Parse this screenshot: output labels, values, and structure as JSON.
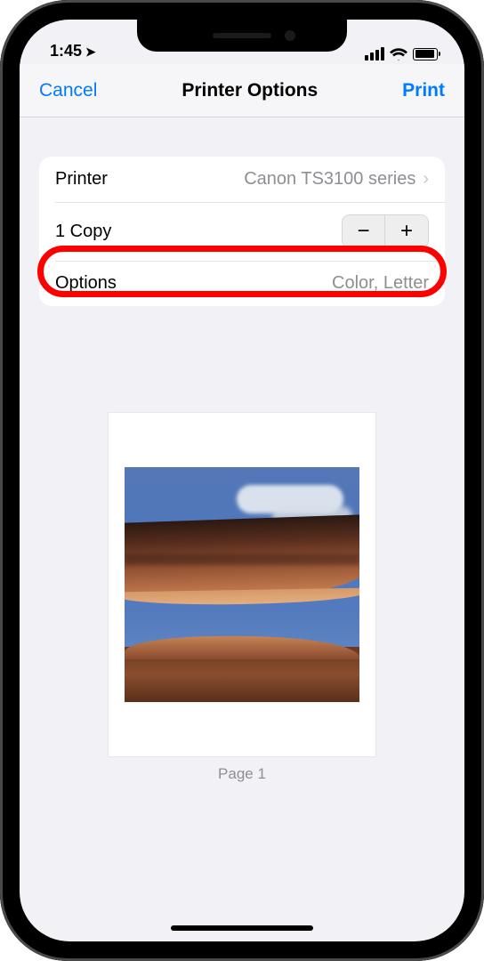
{
  "status_bar": {
    "time": "1:45",
    "location_glyph": "➤"
  },
  "nav": {
    "cancel": "Cancel",
    "title": "Printer Options",
    "print": "Print"
  },
  "rows": {
    "printer": {
      "label": "Printer",
      "value": "Canon TS3100 series"
    },
    "copies": {
      "label": "1 Copy",
      "minus": "−",
      "plus": "+"
    },
    "options": {
      "label": "Options",
      "value": "Color, Letter"
    }
  },
  "preview": {
    "page_label": "Page 1"
  }
}
